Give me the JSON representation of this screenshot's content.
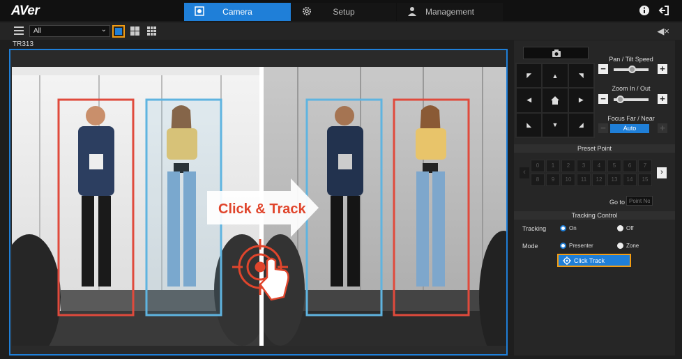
{
  "brand": {
    "logo": "AVer"
  },
  "nav": {
    "tabs": [
      {
        "label": "Camera",
        "active": true
      },
      {
        "label": "Setup",
        "active": false
      },
      {
        "label": "Management",
        "active": false
      }
    ]
  },
  "top_icons": [
    "info-icon",
    "logout-icon"
  ],
  "toolbar": {
    "group_select": "All",
    "layouts": [
      "single-view",
      "quad-view",
      "nine-view"
    ],
    "active_layout": "single-view"
  },
  "camera": {
    "name": "TR313"
  },
  "video_overlay": {
    "text": "Click & Track"
  },
  "controls": {
    "pan_tilt": {
      "label": "Pan / Tilt Speed",
      "level": 0.55
    },
    "zoom": {
      "label": "Zoom In / Out",
      "level": 0.1
    },
    "focus": {
      "label": "Focus Far / Near",
      "mode": "Auto"
    }
  },
  "presets": {
    "label": "Preset Point",
    "points": [
      "0",
      "1",
      "2",
      "3",
      "4",
      "5",
      "6",
      "7",
      "8",
      "9",
      "10",
      "11",
      "12",
      "13",
      "14",
      "15"
    ],
    "goto_label": "Go to",
    "goto_placeholder": "Point No."
  },
  "tracking": {
    "label": "Tracking Control",
    "tracking_label": "Tracking",
    "tracking_on": "On",
    "tracking_off": "Off",
    "tracking_state": "On",
    "mode_label": "Mode",
    "mode_presenter": "Presenter",
    "mode_zone": "Zone",
    "mode_state": "Presenter",
    "click_track": "Click Track"
  },
  "colors": {
    "accent": "#1f7fd8",
    "highlight": "#f39c12",
    "box_red": "#e04a3c",
    "box_blue": "#5fb4e0"
  }
}
